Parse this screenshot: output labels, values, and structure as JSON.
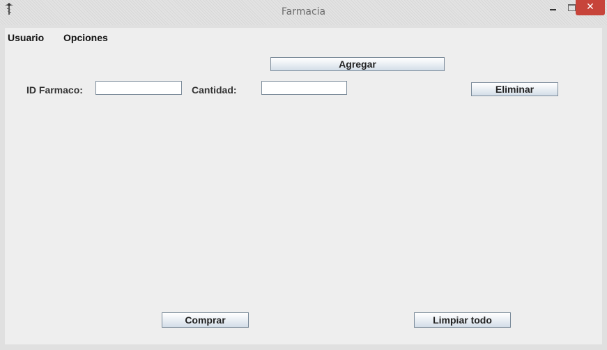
{
  "window": {
    "title": "Farmacia",
    "close_glyph": "✕"
  },
  "menu": {
    "items": [
      "Usuario",
      "Opciones"
    ]
  },
  "form": {
    "id_label": "ID Farmaco:",
    "id_value": "",
    "cantidad_label": "Cantidad:",
    "cantidad_value": ""
  },
  "buttons": {
    "agregar": "Agregar",
    "eliminar": "Eliminar",
    "comprar": "Comprar",
    "limpiar": "Limpiar todo"
  },
  "colors": {
    "close_button": "#c7443a",
    "panel": "#eeeeee"
  }
}
